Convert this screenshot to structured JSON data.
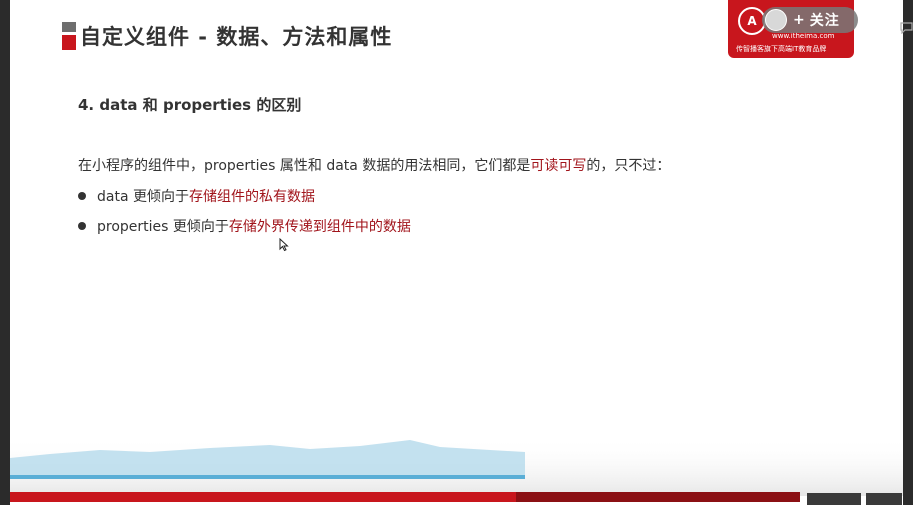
{
  "slide": {
    "title": "自定义组件 - 数据、方法和属性",
    "section_heading": "4. data 和 properties 的区别",
    "intro": {
      "before": "在小程序的组件中，properties 属性和 data 数据的用法相同，它们都是",
      "highlight": "可读可写",
      "after": "的，只不过："
    },
    "bullets": [
      {
        "prefix": "data 更倾向于",
        "highlight": "存储组件的私有数据"
      },
      {
        "prefix": "properties 更倾向于",
        "highlight": "存储外界传递到组件中的数据"
      }
    ]
  },
  "logo": {
    "mark": "A",
    "url": "www.itheima.com",
    "slogan": "传智播客旗下高端IT教育品牌"
  },
  "overlay": {
    "follow_label": "关注"
  },
  "player": {
    "progress": 0.64
  },
  "colors": {
    "brand_red": "#c8161d",
    "highlight_red": "#a1141b",
    "text": "#333333"
  }
}
